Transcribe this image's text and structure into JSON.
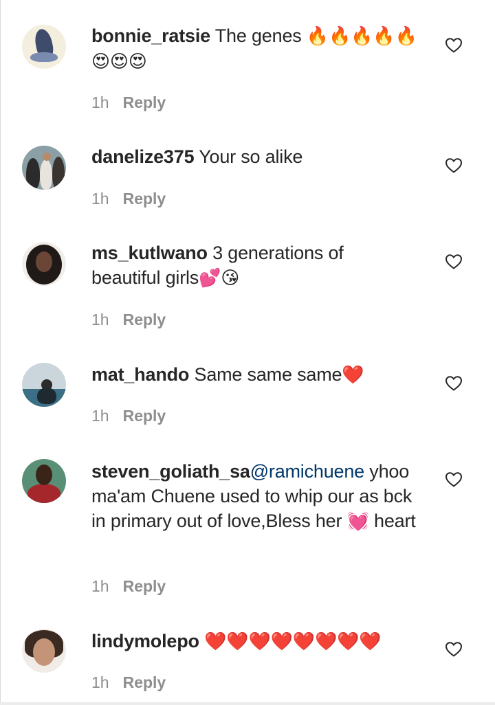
{
  "comments": [
    {
      "username": "bonnie_ratsie",
      "mention": "",
      "text": " The genes ",
      "emojis": "🔥🔥🔥🔥🔥😍😍😍",
      "time": "1h",
      "reply": "Reply"
    },
    {
      "username": "danelize375",
      "mention": "",
      "text": " Your so alike",
      "emojis": "",
      "time": "1h",
      "reply": "Reply"
    },
    {
      "username": "ms_kutlwano",
      "mention": "",
      "text": " 3 generations of beautiful girls",
      "emojis": "💕😘",
      "time": "1h",
      "reply": "Reply"
    },
    {
      "username": "mat_hando",
      "mention": "",
      "text": " Same same same",
      "emojis": "❤️",
      "time": "1h",
      "reply": "Reply"
    },
    {
      "username": "steven_goliath_sa",
      "mention": "@ramichuene",
      "text": " yhoo ma'am Chuene used to whip our as bck in primary out of love,Bless her ",
      "text_after": " heart",
      "emojis": "💓",
      "time": "1h",
      "reply": "Reply"
    },
    {
      "username": "lindymolepo",
      "mention": "",
      "text": " ",
      "emojis": "❤️❤️❤️❤️❤️❤️❤️❤️",
      "time": "1h",
      "reply": "Reply"
    }
  ],
  "icons": {
    "like": "heart-outline-icon"
  },
  "colors": {
    "text": "#262626",
    "meta": "#8e8e8e",
    "mention": "#00376b",
    "heart_emoji": "#e0242f"
  }
}
